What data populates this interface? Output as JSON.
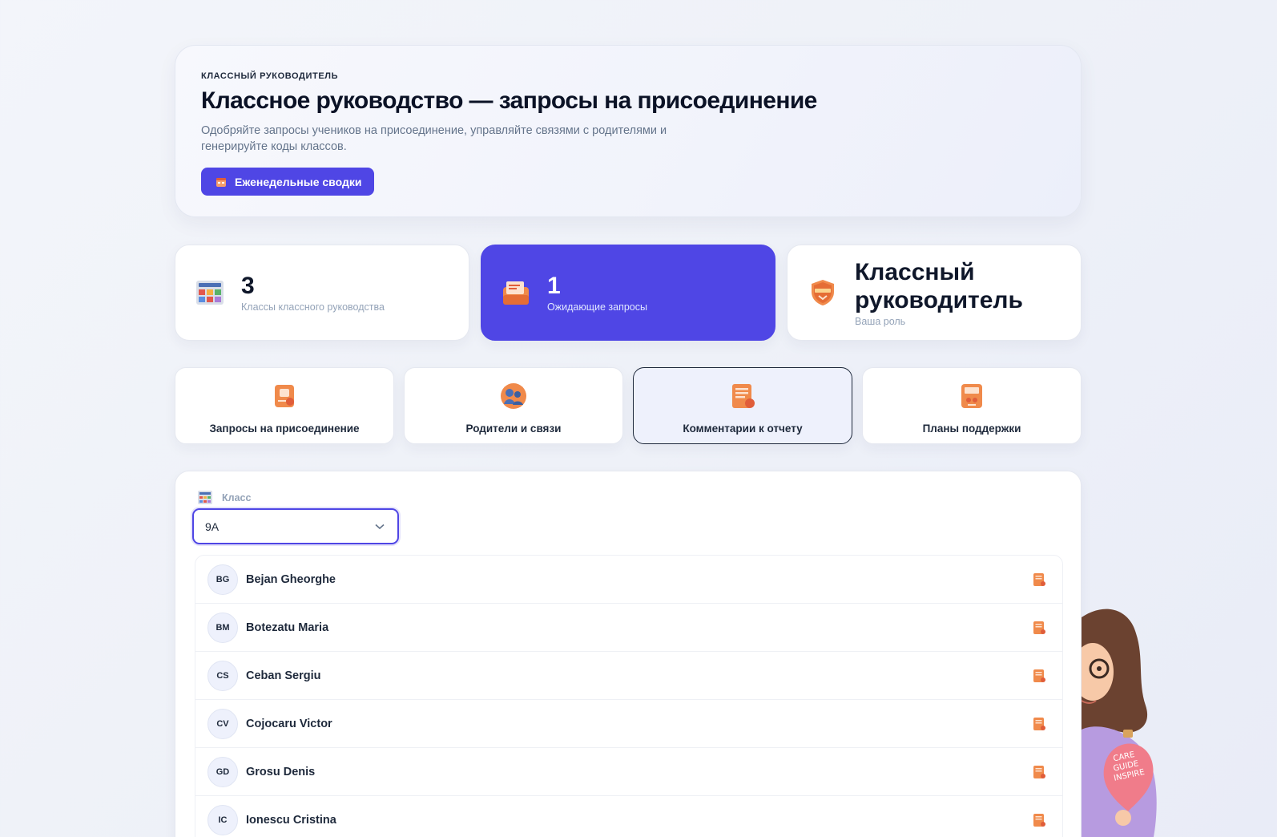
{
  "hero": {
    "eyebrow": "КЛАССНЫЙ РУКОВОДИТЕЛЬ",
    "title": "Классное руководство — запросы на присоединение",
    "subtitle": "Одобряйте запросы учеников на присоединение, управляйте связями с родителями и генерируйте коды классов.",
    "button_label": "Еженедельные сводки",
    "button_icon": "calendar-icon"
  },
  "stats": [
    {
      "value": "3",
      "label": "Классы классного руководства",
      "icon": "classes-grid-icon"
    },
    {
      "value": "1",
      "label": "Ожидающие запросы",
      "icon": "inbox-requests-icon"
    },
    {
      "value": "Классный руководитель",
      "label": "Ваша роль",
      "icon": "shield-badge-icon"
    }
  ],
  "tabs": [
    {
      "label": "Запросы на присоединение",
      "icon": "join-request-icon"
    },
    {
      "label": "Родители и связи",
      "icon": "parents-icon"
    },
    {
      "label": "Комментарии к отчету",
      "icon": "report-comment-icon"
    },
    {
      "label": "Планы поддержки",
      "icon": "support-plan-icon"
    }
  ],
  "active_tab": "Комментарии к отчету",
  "class_filter": {
    "label": "Класс",
    "value": "9A"
  },
  "students": [
    {
      "initials": "BG",
      "name": "Bejan Gheorghe"
    },
    {
      "initials": "BM",
      "name": "Botezatu Maria"
    },
    {
      "initials": "CS",
      "name": "Ceban Sergiu"
    },
    {
      "initials": "CV",
      "name": "Cojocaru Victor"
    },
    {
      "initials": "GD",
      "name": "Grosu Denis"
    },
    {
      "initials": "IC",
      "name": "Ionescu Cristina"
    }
  ],
  "mascot_badge_text": "CARE GUIDE INSPIRE",
  "colors": {
    "accent": "#4f46e5",
    "text": "#0f172a",
    "muted": "#94a3b8"
  }
}
